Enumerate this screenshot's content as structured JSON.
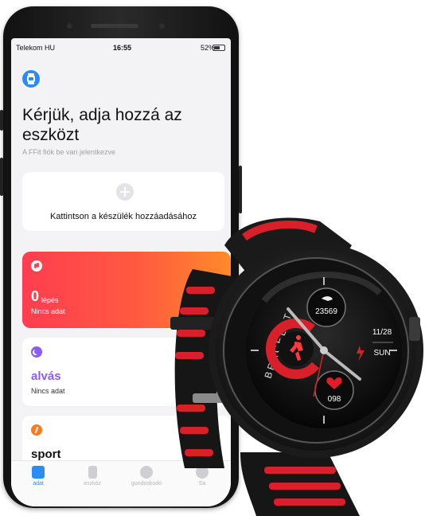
{
  "status_bar": {
    "carrier": "Telekom HU",
    "time": "16:55",
    "battery": "52%"
  },
  "header": {
    "title": "Kérjük, adja hozzá az eszközt",
    "subtitle": "A FFit fiók be van jelentkezve"
  },
  "add_device": {
    "label": "Kattintson a készülék hozzáadásához"
  },
  "steps": {
    "value": "0",
    "unit": "lépés",
    "sub": "Nincs adat"
  },
  "sleep": {
    "title": "alvás",
    "sub": "Nincs adat"
  },
  "sport": {
    "title": "sport"
  },
  "tabs": [
    {
      "label": "adat",
      "icon": "data-icon",
      "active": true
    },
    {
      "label": "eszköz",
      "icon": "device-icon",
      "active": false
    },
    {
      "label": "gondoskodó",
      "icon": "care-icon",
      "active": false
    },
    {
      "label": "Sa",
      "icon": "settings-icon",
      "active": false
    }
  ],
  "watch": {
    "brand": "BRACELET",
    "steps_value": "23569",
    "date": "11/28",
    "day": "SUN",
    "heart_rate": "098"
  },
  "colors": {
    "accent_blue": "#2b8cf5",
    "steps_red": "#ff4848",
    "sleep_purple": "#8b5cf6",
    "sport_orange": "#ff7a1a",
    "watch_red": "#d8202a"
  }
}
